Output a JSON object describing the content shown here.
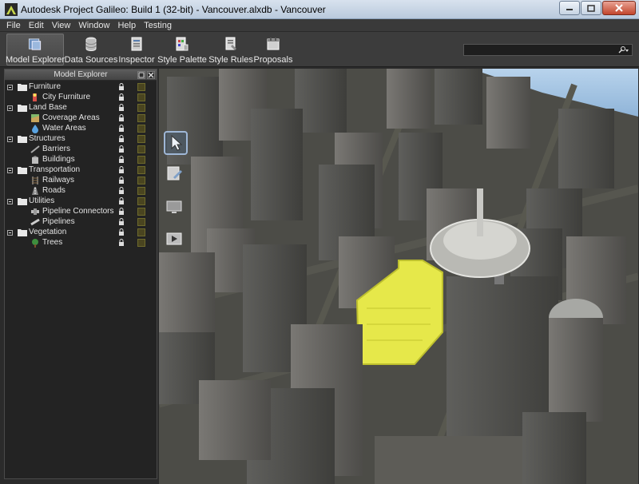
{
  "window": {
    "title": "Autodesk Project Galileo: Build 1 (32-bit) - Vancouver.alxdb - Vancouver",
    "minimize_icon": "minimize-icon",
    "maximize_icon": "maximize-icon",
    "close_icon": "close-icon"
  },
  "menu": [
    "File",
    "Edit",
    "View",
    "Window",
    "Help",
    "Testing"
  ],
  "toolbar": {
    "items": [
      {
        "label": "Model Explorer",
        "icon": "model-explorer-icon",
        "active": true
      },
      {
        "label": "Data Sources",
        "icon": "database-icon"
      },
      {
        "label": "Inspector",
        "icon": "inspector-icon"
      },
      {
        "label": "Style Palette",
        "icon": "style-palette-icon"
      },
      {
        "label": "Style Rules",
        "icon": "style-rules-icon"
      },
      {
        "label": "Proposals",
        "icon": "proposals-icon"
      }
    ],
    "search_value": ""
  },
  "panel": {
    "title": "Model Explorer",
    "tree": [
      {
        "label": "Furniture",
        "level": 0,
        "type": "folder"
      },
      {
        "label": "City Furniture",
        "level": 1,
        "type": "leaf",
        "icon": "city-furniture-icon"
      },
      {
        "label": "Land Base",
        "level": 0,
        "type": "folder"
      },
      {
        "label": "Coverage Areas",
        "level": 1,
        "type": "leaf",
        "icon": "coverage-areas-icon"
      },
      {
        "label": "Water Areas",
        "level": 1,
        "type": "leaf",
        "icon": "water-drop-icon"
      },
      {
        "label": "Structures",
        "level": 0,
        "type": "folder"
      },
      {
        "label": "Barriers",
        "level": 1,
        "type": "leaf",
        "icon": "barrier-icon"
      },
      {
        "label": "Buildings",
        "level": 1,
        "type": "leaf",
        "icon": "building-icon"
      },
      {
        "label": "Transportation",
        "level": 0,
        "type": "folder"
      },
      {
        "label": "Railways",
        "level": 1,
        "type": "leaf",
        "icon": "railway-icon"
      },
      {
        "label": "Roads",
        "level": 1,
        "type": "leaf",
        "icon": "road-icon"
      },
      {
        "label": "Utilities",
        "level": 0,
        "type": "folder"
      },
      {
        "label": "Pipeline Connectors",
        "level": 1,
        "type": "leaf",
        "icon": "pipeline-connector-icon"
      },
      {
        "label": "Pipelines",
        "level": 1,
        "type": "leaf",
        "icon": "pipeline-icon"
      },
      {
        "label": "Vegetation",
        "level": 0,
        "type": "folder"
      },
      {
        "label": "Trees",
        "level": 1,
        "type": "leaf",
        "icon": "tree-icon"
      }
    ]
  },
  "viewport": {
    "tools": [
      {
        "icon": "select-cursor-icon",
        "active": true
      },
      {
        "icon": "sketch-edit-icon"
      },
      {
        "icon": "screen-display-icon"
      },
      {
        "icon": "media-play-icon"
      }
    ],
    "highlight_color": "#e6e84a"
  },
  "colors": {
    "chrome": "#3c3c3c",
    "panel_bg": "#232323",
    "text": "#e4e4e4"
  }
}
